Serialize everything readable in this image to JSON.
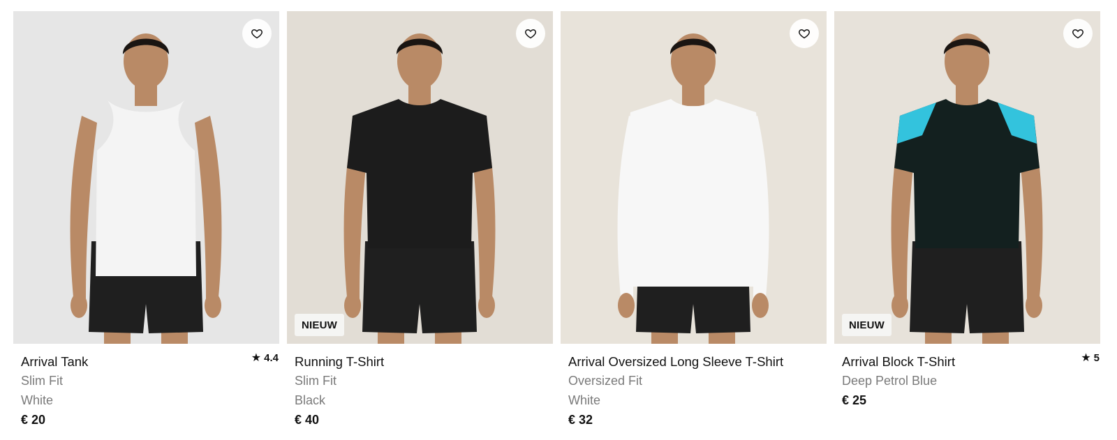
{
  "products": [
    {
      "name": "Arrival Tank",
      "fit": "Slim Fit",
      "color_name": "White",
      "price": "€ 20",
      "rating": "4.4",
      "badge": "",
      "bg": "#e6e6e6",
      "garment": "tank",
      "garment_color": "#f4f4f4"
    },
    {
      "name": "Running T-Shirt",
      "fit": "Slim Fit",
      "color_name": "Black",
      "price": "€ 40",
      "rating": "",
      "badge": "NIEUW",
      "bg": "#e2ddd5",
      "garment": "tee",
      "garment_color": "#1c1c1c"
    },
    {
      "name": "Arrival Oversized Long Sleeve T-Shirt",
      "fit": "Oversized Fit",
      "color_name": "White",
      "price": "€ 32",
      "rating": "",
      "badge": "",
      "bg": "#e8e3da",
      "garment": "longsleeve",
      "garment_color": "#f7f7f7"
    },
    {
      "name": "Arrival Block T-Shirt",
      "fit": "Deep Petrol Blue",
      "color_name": "",
      "price": "€ 25",
      "rating": "5",
      "badge": "NIEUW",
      "bg": "#e7e2da",
      "garment": "blocktee",
      "garment_color": "#13201f",
      "accent_color": "#33c3dd"
    }
  ],
  "icons": {
    "wishlist": "heart-outline-icon",
    "rating": "star-icon"
  },
  "colors": {
    "skin": "#b98a66",
    "shorts": "#1f1f1f",
    "hair": "#1a1512"
  }
}
